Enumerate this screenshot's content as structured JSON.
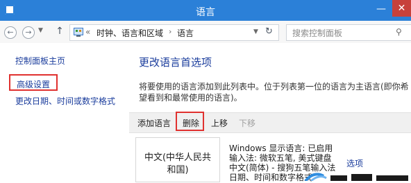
{
  "window": {
    "title": "语言",
    "minimize_glyph": "—",
    "close_glyph": "✕"
  },
  "toolbar": {
    "back_icon": "back-arrow-icon",
    "forward_icon": "forward-arrow-icon",
    "up_icon": "up-arrow-icon",
    "breadcrumb": {
      "overflow": "«",
      "items": [
        "时钟、语言和区域",
        "语言"
      ],
      "separator": "›"
    },
    "search_placeholder": "搜索控制面板"
  },
  "sidebar": {
    "items": [
      {
        "label": "控制面板主页"
      },
      {
        "label": "高级设置",
        "highlighted": true
      },
      {
        "label": "更改日期、时间或数字格式"
      }
    ]
  },
  "main": {
    "title": "更改语言首选项",
    "description_lines": [
      "将要使用的语言添加到此列表中。位于列表第一位的语言为主语言(即你希",
      "望看到和最常使用的语言)。"
    ],
    "commands": [
      {
        "label": "添加语言",
        "enabled": true
      },
      {
        "label": "删除",
        "enabled": true,
        "highlighted": true
      },
      {
        "label": "上移",
        "enabled": true
      },
      {
        "label": "下移",
        "enabled": false
      }
    ],
    "language": {
      "name_lines": [
        "中文(中华人民共",
        "和国)"
      ],
      "details": [
        "Windows 显示语言: 已启用",
        "输入法: 微软五笔, 美式键盘",
        "中文(简体) - 搜狗五笔输入法",
        "日期、时间和数字格式"
      ],
      "options_label": "选项"
    }
  },
  "colors": {
    "titlebar": "#2b80d8",
    "close": "#c7413b",
    "link": "#1a3c9c",
    "highlight": "#e0312f"
  }
}
